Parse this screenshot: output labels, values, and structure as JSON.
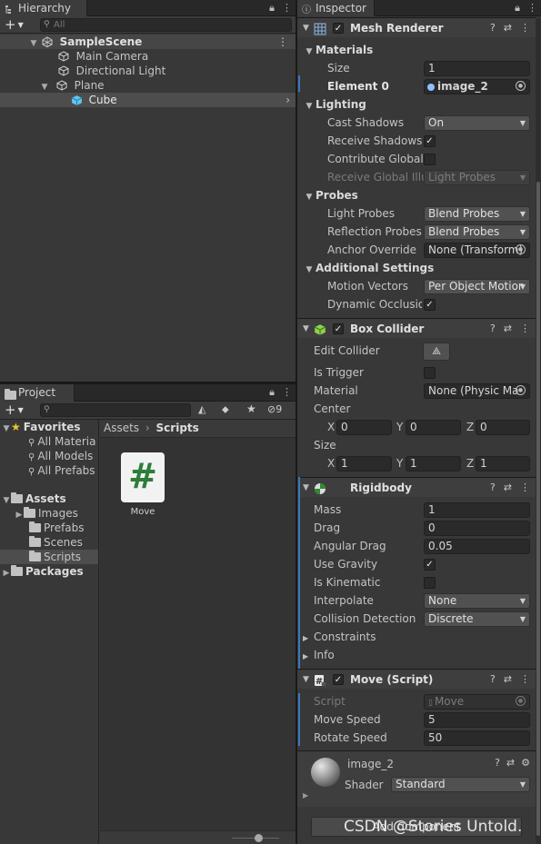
{
  "hierarchy": {
    "tab_label": "Hierarchy",
    "search_placeholder": "All",
    "rows": [
      {
        "label": "SampleScene"
      },
      {
        "label": "Main Camera"
      },
      {
        "label": "Directional Light"
      },
      {
        "label": "Plane"
      },
      {
        "label": "Cube"
      }
    ]
  },
  "project": {
    "tab_label": "Project",
    "hidden_count": "9",
    "tree": [
      {
        "label": "Favorites"
      },
      {
        "label": "All Materia"
      },
      {
        "label": "All Models"
      },
      {
        "label": "All Prefabs"
      },
      {
        "label": "Assets"
      },
      {
        "label": "Images"
      },
      {
        "label": "Prefabs"
      },
      {
        "label": "Scenes"
      },
      {
        "label": "Scripts"
      },
      {
        "label": "Packages"
      }
    ],
    "breadcrumb": [
      "Assets",
      "Scripts"
    ],
    "assets": [
      {
        "label": "Move",
        "glyph": "#"
      }
    ]
  },
  "inspector": {
    "tab_label": "Inspector",
    "mesh_renderer": {
      "title": "Mesh Renderer",
      "materials_label": "Materials",
      "size_label": "Size",
      "size_value": "1",
      "element_label": "Element 0",
      "element_value": "image_2",
      "lighting_label": "Lighting",
      "cast_shadows_label": "Cast Shadows",
      "cast_shadows_value": "On",
      "receive_shadows_label": "Receive Shadows",
      "receive_shadows_checked": true,
      "contribute_gi_label": "Contribute Global I",
      "contribute_gi_checked": false,
      "receive_gi_label": "Receive Global Illu",
      "receive_gi_value": "Light Probes",
      "probes_label": "Probes",
      "light_probes_label": "Light Probes",
      "light_probes_value": "Blend Probes",
      "reflection_probes_label": "Reflection Probes",
      "reflection_probes_value": "Blend Probes",
      "anchor_override_label": "Anchor Override",
      "anchor_override_value": "None (Transform)",
      "additional_label": "Additional Settings",
      "motion_vectors_label": "Motion Vectors",
      "motion_vectors_value": "Per Object Motior",
      "dynamic_occlusion_label": "Dynamic Occlusion",
      "dynamic_occlusion_checked": true
    },
    "box_collider": {
      "title": "Box Collider",
      "edit_collider_label": "Edit Collider",
      "is_trigger_label": "Is Trigger",
      "is_trigger_checked": false,
      "material_label": "Material",
      "material_value": "None (Physic Ma",
      "center_label": "Center",
      "center": {
        "x": "0",
        "y": "0",
        "z": "0"
      },
      "size_label": "Size",
      "size": {
        "x": "1",
        "y": "1",
        "z": "1"
      },
      "axis_x": "X",
      "axis_y": "Y",
      "axis_z": "Z"
    },
    "rigidbody": {
      "title": "Rigidbody",
      "mass_label": "Mass",
      "mass_value": "1",
      "drag_label": "Drag",
      "drag_value": "0",
      "angular_drag_label": "Angular Drag",
      "angular_drag_value": "0.05",
      "use_gravity_label": "Use Gravity",
      "use_gravity_checked": true,
      "is_kinematic_label": "Is Kinematic",
      "is_kinematic_checked": false,
      "interpolate_label": "Interpolate",
      "interpolate_value": "None",
      "collision_detection_label": "Collision Detection",
      "collision_detection_value": "Discrete",
      "constraints_label": "Constraints",
      "info_label": "Info"
    },
    "move_script": {
      "title": "Move (Script)",
      "script_label": "Script",
      "script_value": "Move",
      "move_speed_label": "Move Speed",
      "move_speed_value": "5",
      "rotate_speed_label": "Rotate Speed",
      "rotate_speed_value": "50"
    },
    "material": {
      "name": "image_2",
      "shader_label": "Shader",
      "shader_value": "Standard"
    },
    "add_component_label": "Add Component"
  },
  "watermark": "CSDN @Stories Untold.",
  "colors": {
    "selection_blue": "#3a79bb",
    "cube_icon": "#5fc6f0",
    "script_hash": "#2e7d3a",
    "favorites_star": "#f0c230"
  }
}
